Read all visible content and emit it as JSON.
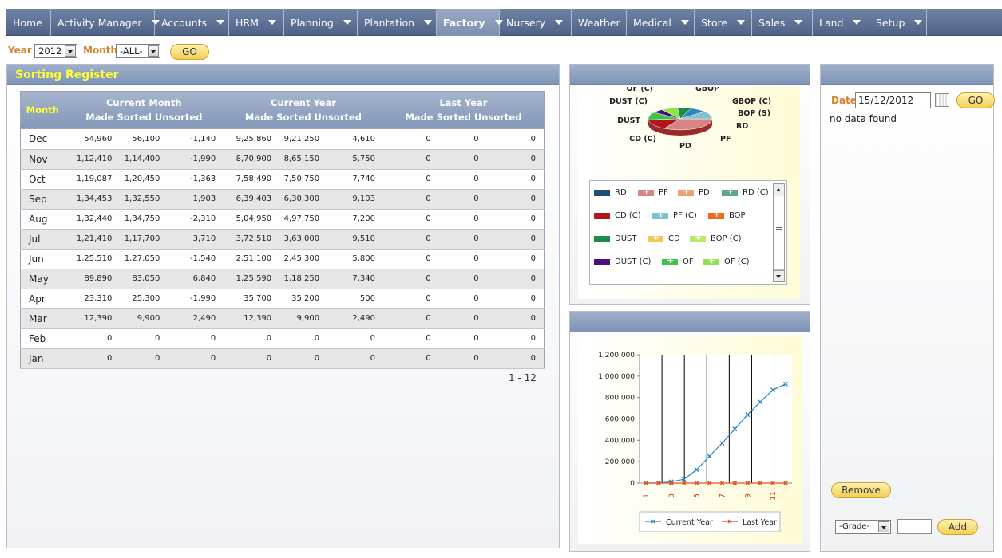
{
  "nav": {
    "items": [
      {
        "label": "Home",
        "caret": false,
        "w": 56
      },
      {
        "label": "Activity Manager",
        "caret": true,
        "w": 130
      },
      {
        "label": "Accounts",
        "caret": true,
        "w": 93
      },
      {
        "label": "HRM",
        "caret": true,
        "w": 69
      },
      {
        "label": "Planning",
        "caret": true,
        "w": 92
      },
      {
        "label": "Plantation",
        "caret": true,
        "w": 99
      },
      {
        "label": "Factory",
        "caret": true,
        "w": 79,
        "active": true
      },
      {
        "label": "Nursery",
        "caret": true,
        "w": 90
      },
      {
        "label": "Weather",
        "caret": false,
        "w": 69
      },
      {
        "label": "Medical",
        "caret": true,
        "w": 85
      },
      {
        "label": "Store",
        "caret": true,
        "w": 72
      },
      {
        "label": "Sales",
        "caret": true,
        "w": 76
      },
      {
        "label": "Land",
        "caret": true,
        "w": 71
      },
      {
        "label": "Setup",
        "caret": true,
        "w": 72
      }
    ]
  },
  "filters": {
    "year_label": "Year",
    "year_value": "2012",
    "month_label": "Month",
    "month_value": "-ALL-",
    "go_label": "GO"
  },
  "register": {
    "title": "Sorting Register",
    "month_header": "Month",
    "groups": [
      "Current Month",
      "Current Year",
      "Last Year"
    ],
    "subheaders": "Made  Sorted  Unsorted",
    "rows": [
      [
        "Dec",
        "54,960",
        "56,100",
        "-1,140",
        "9,25,860",
        "9,21,250",
        "4,610",
        "0",
        "0",
        "0"
      ],
      [
        "Nov",
        "1,12,410",
        "1,14,400",
        "-1,990",
        "8,70,900",
        "8,65,150",
        "5,750",
        "0",
        "0",
        "0"
      ],
      [
        "Oct",
        "1,19,087",
        "1,20,450",
        "-1,363",
        "7,58,490",
        "7,50,750",
        "7,740",
        "0",
        "0",
        "0"
      ],
      [
        "Sep",
        "1,34,453",
        "1,32,550",
        "1,903",
        "6,39,403",
        "6,30,300",
        "9,103",
        "0",
        "0",
        "0"
      ],
      [
        "Aug",
        "1,32,440",
        "1,34,750",
        "-2,310",
        "5,04,950",
        "4,97,750",
        "7,200",
        "0",
        "0",
        "0"
      ],
      [
        "Jul",
        "1,21,410",
        "1,17,700",
        "3,710",
        "3,72,510",
        "3,63,000",
        "9,510",
        "0",
        "0",
        "0"
      ],
      [
        "Jun",
        "1,25,510",
        "1,27,050",
        "-1,540",
        "2,51,100",
        "2,45,300",
        "5,800",
        "0",
        "0",
        "0"
      ],
      [
        "May",
        "89,890",
        "83,050",
        "6,840",
        "1,25,590",
        "1,18,250",
        "7,340",
        "0",
        "0",
        "0"
      ],
      [
        "Apr",
        "23,310",
        "25,300",
        "-1,990",
        "35,700",
        "35,200",
        "500",
        "0",
        "0",
        "0"
      ],
      [
        "Mar",
        "12,390",
        "9,900",
        "2,490",
        "12,390",
        "9,900",
        "2,490",
        "0",
        "0",
        "0"
      ],
      [
        "Feb",
        "0",
        "0",
        "0",
        "0",
        "0",
        "0",
        "0",
        "0",
        "0"
      ],
      [
        "Jan",
        "0",
        "0",
        "0",
        "0",
        "0",
        "0",
        "0",
        "0",
        "0"
      ]
    ],
    "pagination": "1 - 12"
  },
  "pie_panel": {
    "labels": [
      "OF (C)",
      "GBOP",
      "DUST (C)",
      "GBOP (C)",
      "BOP (S)",
      "DUST",
      "RD",
      "CD (C)",
      "PF",
      "PD"
    ],
    "legend": [
      {
        "label": "RD",
        "color": "#1f4e79",
        "plus": false
      },
      {
        "label": "PF",
        "color": "#d98484",
        "plus": true
      },
      {
        "label": "PD",
        "color": "#f0a070",
        "plus": true
      },
      {
        "label": "RD (C)",
        "color": "#5fa58a",
        "plus": true
      },
      {
        "label": "CD (C)",
        "color": "#b0161d",
        "plus": false
      },
      {
        "label": "PF (C)",
        "color": "#7ec4cf",
        "plus": true
      },
      {
        "label": "BOP",
        "color": "#f26b1d",
        "plus": true
      },
      {
        "label": "DUST",
        "color": "#1f8a4c",
        "plus": false
      },
      {
        "label": "CD",
        "color": "#f2c45a",
        "plus": true
      },
      {
        "label": "BOP (C)",
        "color": "#b9e86a",
        "plus": true
      },
      {
        "label": "DUST (C)",
        "color": "#4b0f7a",
        "plus": false
      },
      {
        "label": "OF",
        "color": "#3fc24a",
        "plus": true
      },
      {
        "label": "OF (C)",
        "color": "#8fe34a",
        "plus": true
      }
    ]
  },
  "chart_data": {
    "type": "line",
    "x": [
      1,
      2,
      3,
      4,
      5,
      6,
      7,
      8,
      9,
      10,
      11,
      12
    ],
    "x_tick_labels": [
      "1",
      "3",
      "5",
      "7",
      "9",
      "11"
    ],
    "y_tick_labels": [
      "0",
      "200,000",
      "400,000",
      "600,000",
      "800,000",
      "1,000,000",
      "1,200,000"
    ],
    "ylim": [
      0,
      1200000
    ],
    "series": [
      {
        "name": "Current Year",
        "color": "#2e86c1",
        "values": [
          0,
          0,
          12390,
          35700,
          125590,
          251100,
          372510,
          504950,
          639403,
          758490,
          870900,
          925860
        ]
      },
      {
        "name": "Last Year",
        "color": "#d9541e",
        "values": [
          0,
          0,
          0,
          0,
          0,
          0,
          0,
          0,
          0,
          0,
          0,
          0
        ]
      }
    ]
  },
  "side_panel": {
    "date_label": "Date",
    "date_value": "15/12/2012",
    "go_label": "GO",
    "message": "no data found",
    "remove_label": "Remove",
    "grade_value": "-Grade-",
    "add_label": "Add"
  }
}
